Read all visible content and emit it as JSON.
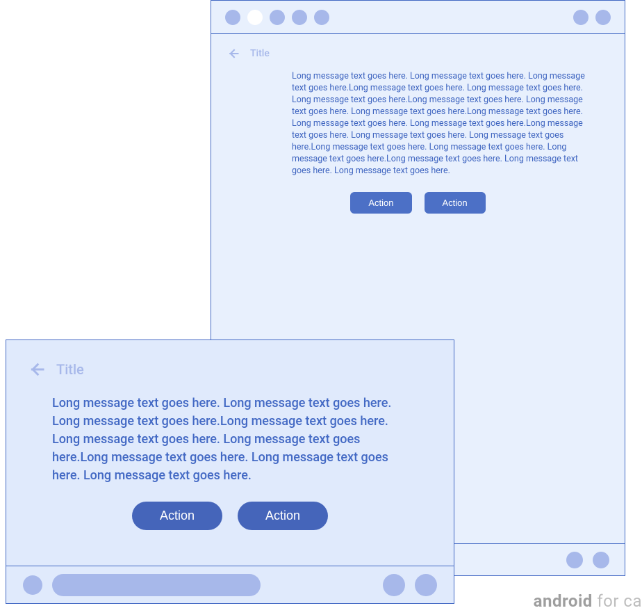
{
  "portrait": {
    "title": "Title",
    "message": "Long message text goes here. Long message text goes here. Long message text goes here.Long message text goes here. Long message text goes here. Long message text goes here.Long message text goes here. Long message text goes here. Long message text goes here.Long message text goes here. Long message text goes here. Long message text goes here.Long message text goes here. Long message text goes here. Long message text goes here.Long message text goes here. Long message text goes here. Long message text goes here.Long message text goes here. Long message text goes here. Long message text goes here.",
    "actions": {
      "primary": "Action",
      "secondary": "Action"
    }
  },
  "landscape": {
    "title": "Title",
    "message": "Long message text goes here. Long message text goes here. Long message text goes here.Long message text goes here. Long message text goes here. Long message text goes here.Long message text goes here. Long message text goes here. Long message text goes here.",
    "actions": {
      "primary": "Action",
      "secondary": "Action"
    }
  },
  "watermark": {
    "brand": "android",
    "suffix": " for ca"
  }
}
